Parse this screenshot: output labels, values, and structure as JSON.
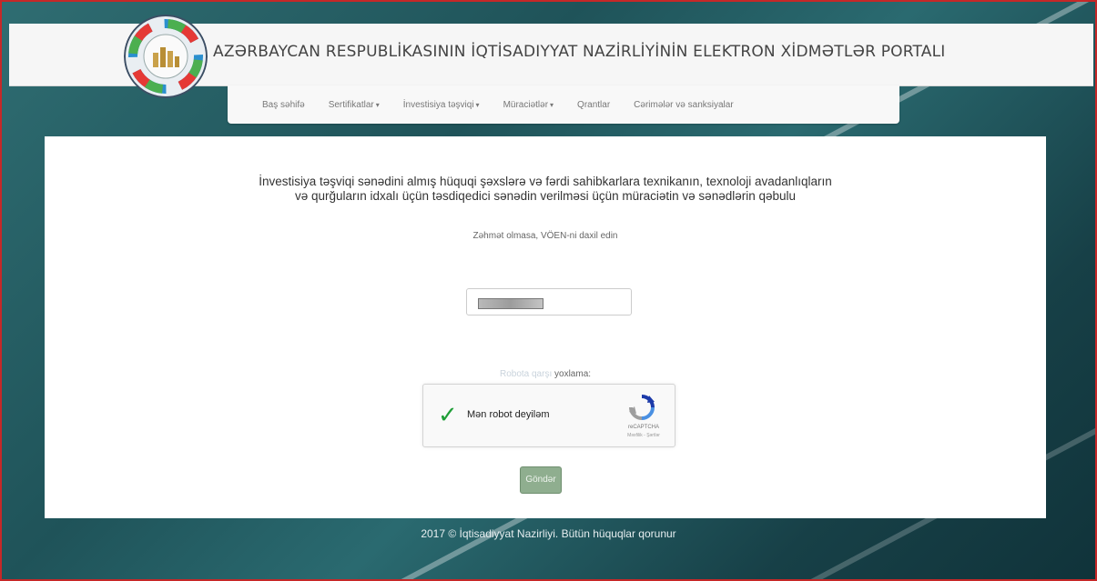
{
  "header": {
    "title": "AZƏRBAYCAN RESPUBLİKASININ İQTİSADIYYAT NAZİRLİYİNİN ELEKTRON XİDMƏTLƏR PORTALI",
    "logo_icon": "ministry-gear-logo"
  },
  "nav": {
    "items": [
      {
        "label": "Baş səhifə",
        "dropdown": false
      },
      {
        "label": "Sertifikatlar",
        "dropdown": true
      },
      {
        "label": "İnvestisiya təşviqi",
        "dropdown": true
      },
      {
        "label": "Müraciətlər",
        "dropdown": true
      },
      {
        "label": "Qrantlar",
        "dropdown": false
      },
      {
        "label": "Cərimələr və sanksiyalar",
        "dropdown": false
      }
    ]
  },
  "main": {
    "heading_line1": "İnvestisiya təşviqi sənədini almış hüquqi şəxslərə və fərdi sahibkarlara texnikanın, texnoloji avadanlıqların",
    "heading_line2": "və qurğuların idxalı üçün təsdiqedici sənədin verilməsi üçün müraciətin və sənədlərin qəbulu",
    "instruction": "Zəhmət olmasa, VÖEN-ni daxil edin",
    "voen_value": "",
    "captcha_label_hidden": "Robota qarşı",
    "captcha_label_visible": " yoxlama:",
    "recaptcha": {
      "label": "Mən robot deyiləm",
      "brand": "reCAPTCHA",
      "links": "Məxfilik - Şərtlər",
      "checked": true
    },
    "submit_label": "Göndər"
  },
  "footer": {
    "text": "2017 © İqtisadiyyat Nazirliyi. Bütün hüquqlar qorunur"
  },
  "colors": {
    "background": "#1f5359",
    "submit_button": "#8fae8f",
    "check": "#1e9e37",
    "frame_border": "#c62828"
  }
}
